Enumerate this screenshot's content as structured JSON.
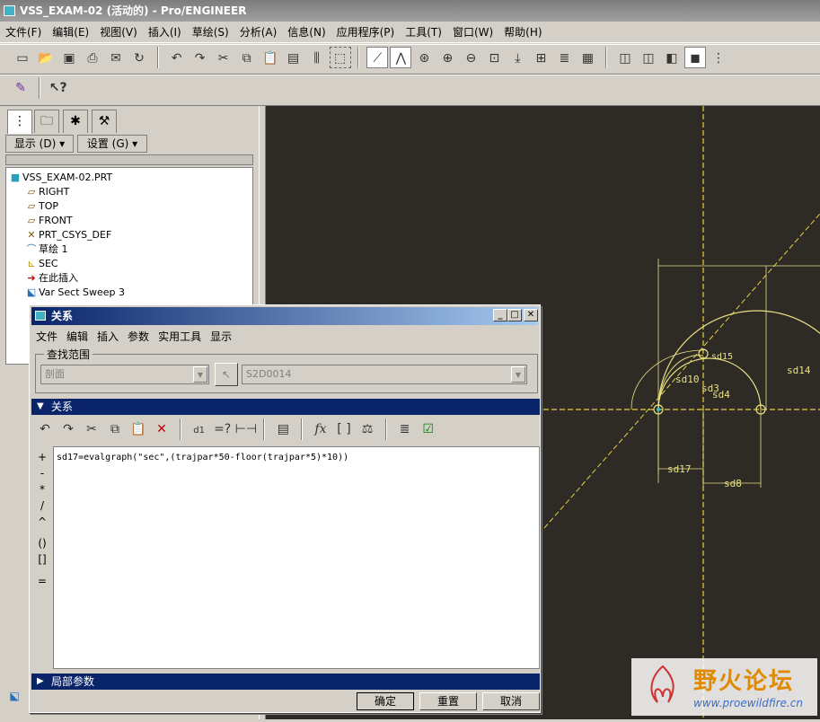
{
  "window": {
    "title": "VSS_EXAM-02 (活动的) - Pro/ENGINEER"
  },
  "menu": [
    "文件(F)",
    "编辑(E)",
    "视图(V)",
    "插入(I)",
    "草绘(S)",
    "分析(A)",
    "信息(N)",
    "应用程序(P)",
    "工具(T)",
    "窗口(W)",
    "帮助(H)"
  ],
  "left_panel": {
    "show_label": "显示 (D) ▾",
    "settings_label": "设置 (G) ▾",
    "tree": [
      {
        "label": "VSS_EXAM-02.PRT",
        "icon": "part-icon"
      },
      {
        "label": "RIGHT",
        "icon": "datum-plane-icon"
      },
      {
        "label": "TOP",
        "icon": "datum-plane-icon"
      },
      {
        "label": "FRONT",
        "icon": "datum-plane-icon"
      },
      {
        "label": "PRT_CSYS_DEF",
        "icon": "csys-icon"
      },
      {
        "label": "草绘 1",
        "icon": "sketch-icon"
      },
      {
        "label": "SEC",
        "icon": "graph-icon"
      },
      {
        "label": "在此插入",
        "icon": "insert-here-icon"
      },
      {
        "label": "Var Sect Sweep 3",
        "icon": "sweep-icon"
      }
    ]
  },
  "graphics": {
    "dim_labels": [
      "sd14",
      "sd10",
      "sd3",
      "sd4",
      "sd17",
      "sd8",
      "sd15"
    ],
    "colors": {
      "background": "#2e2b26",
      "sketch": "#e8e080",
      "centerline": "#e6d040"
    }
  },
  "dialog": {
    "title": "关系",
    "menu": [
      "文件",
      "编辑",
      "插入",
      "参数",
      "实用工具",
      "显示"
    ],
    "scope_label": "查找范围",
    "scope_combo": "剖面",
    "scope_value": "S2D0014",
    "relations_header": "关系",
    "relation_text": "sd17=evalgraph(\"sec\",(trajpar*50-floor(trajpar*5)*10))",
    "operators": [
      "+",
      "-",
      "*",
      "/",
      "^",
      "()",
      "[]",
      "="
    ],
    "local_params_header": "局部参数",
    "buttons": {
      "ok": "确定",
      "reset": "重置",
      "cancel": "取消"
    }
  },
  "watermark": {
    "line1": "野火论坛",
    "line2": "www.proewildfire.cn"
  }
}
